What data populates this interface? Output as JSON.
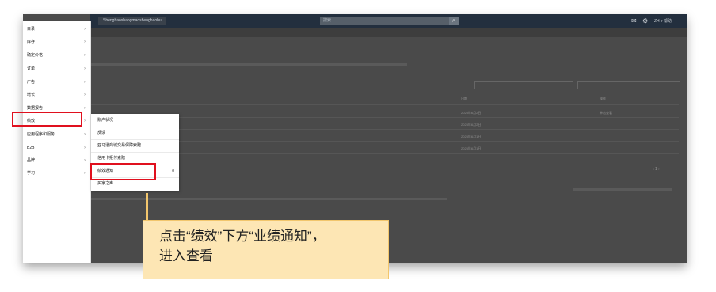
{
  "topbar": {
    "store_selector": "Shenghaoshangmaoshenghaobu",
    "search_placeholder": "搜索",
    "search_icon": "search-icon",
    "right_text": "ZH ▾  帮助"
  },
  "sidebar": {
    "items": [
      {
        "label": "目录"
      },
      {
        "label": "库存"
      },
      {
        "label": "确定价格"
      },
      {
        "label": "订单"
      },
      {
        "label": "广告"
      },
      {
        "label": "增长"
      },
      {
        "label": "数据报告"
      },
      {
        "label": "绩效"
      },
      {
        "label": "应用程序和服务"
      },
      {
        "label": "B2B"
      },
      {
        "label": "品牌"
      },
      {
        "label": "学习"
      }
    ]
  },
  "submenu": {
    "items": [
      {
        "label": "账户状况"
      },
      {
        "label": "反馈"
      },
      {
        "label": "亚马逊商城交易保障索赔"
      },
      {
        "label": "信用卡拒付索赔"
      },
      {
        "label": "绩效通知",
        "suffix": "8"
      },
      {
        "label": "买家之声"
      }
    ]
  },
  "background": {
    "table_headers": [
      "日期",
      "操作"
    ],
    "dates": [
      "2023年6月2日",
      "2023年6月2日",
      "2023年6月1日",
      "2023年6月1日"
    ],
    "row_action": "单击查看",
    "pagination": "‹ 1 ›"
  },
  "callout": {
    "line1": "点击“绩效”下方“业绩通知”，",
    "line2": "进入查看"
  },
  "colors": {
    "highlight": "#e0101e",
    "callout_bg": "#fde6b4",
    "topbar": "#232f3e"
  }
}
